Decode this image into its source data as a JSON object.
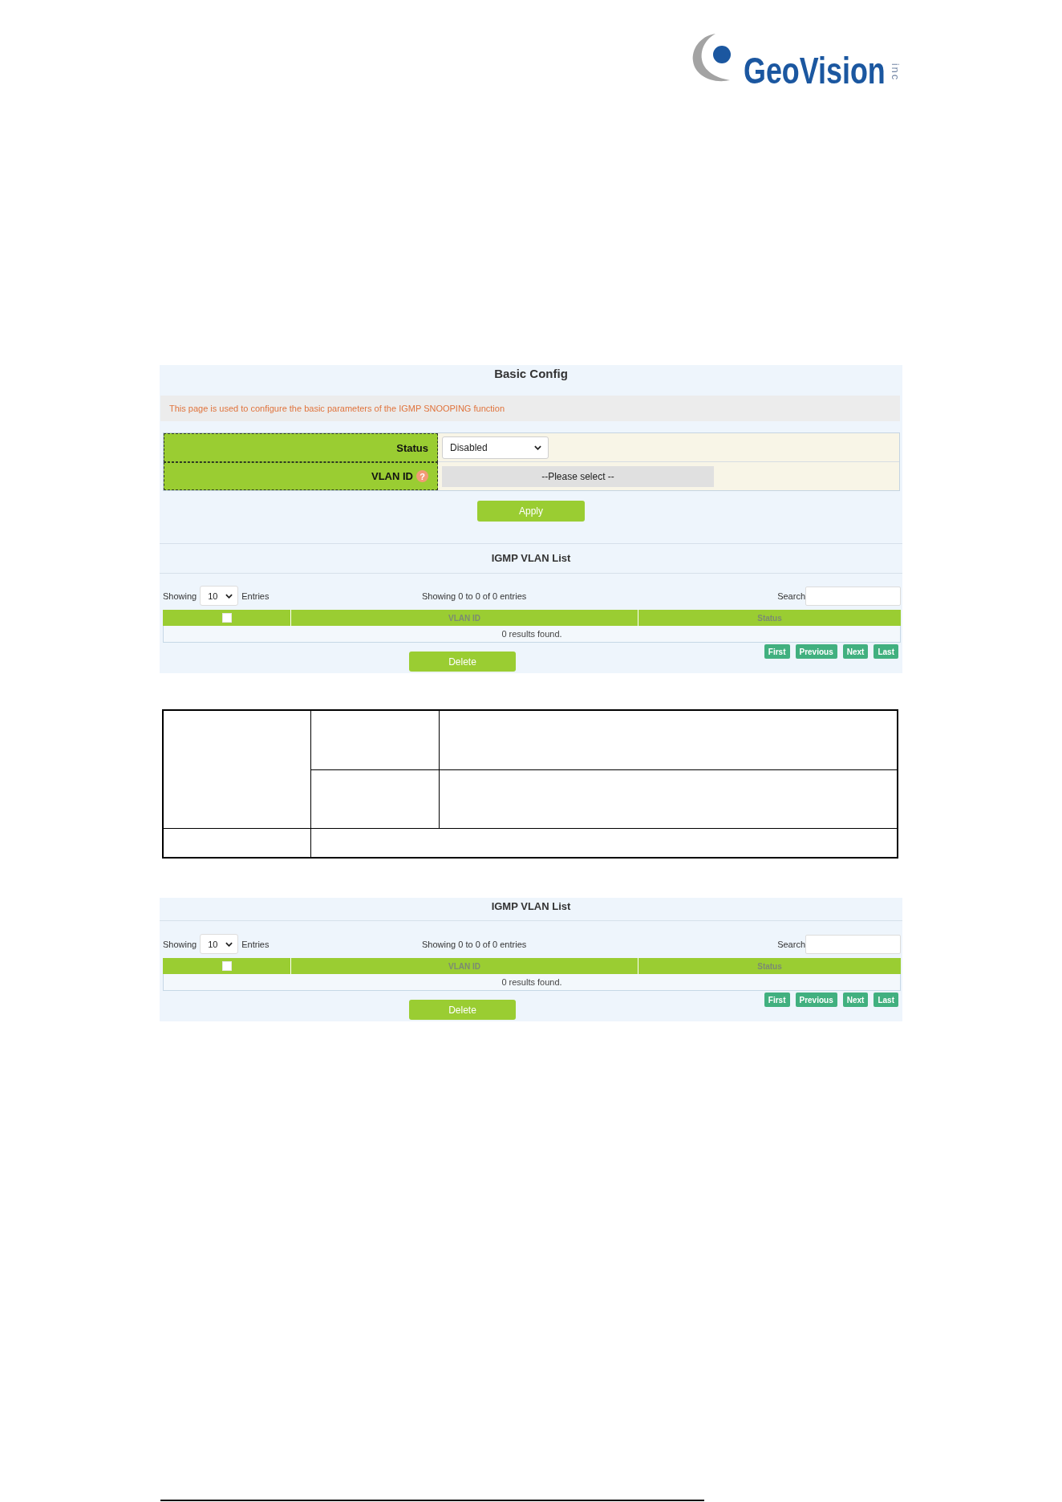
{
  "header": {
    "logo": {
      "wordmark": "GeoVision",
      "suffix": "inc"
    }
  },
  "top_panel": {
    "basic_config": {
      "title": "Basic Config",
      "description": "This page is used to configure the basic parameters of the IGMP SNOOPING function",
      "fields": [
        {
          "kind": "select",
          "label": "Status",
          "value": "Disabled"
        },
        {
          "kind": "picker",
          "label": "VLAN ID",
          "help": "?",
          "value": "--Please select --"
        }
      ],
      "apply_button": "Apply"
    },
    "vlan_list": {
      "title": "IGMP VLAN List",
      "length_label": "Showing",
      "length_value": "10",
      "length_suffix": "Entries",
      "summary": "Showing 0 to 0 of 0 entries",
      "search_label": "Search",
      "select_all": {
        "checked": false
      },
      "columns": [
        "VLAN ID",
        "Status"
      ],
      "empty_message": "0 results found.",
      "delete_button": "Delete",
      "pagination": [
        "First",
        "Previous",
        "Next",
        "Last"
      ]
    }
  },
  "bottom_panel": {
    "vlan_list": {
      "title": "IGMP VLAN List",
      "length_label": "Showing",
      "length_value": "10",
      "length_suffix": "Entries",
      "summary": "Showing 0 to 0 of 0 entries",
      "search_label": "Search",
      "select_all": {
        "checked": false
      },
      "columns": [
        "VLAN ID",
        "Status"
      ],
      "empty_message": "0 results found.",
      "delete_button": "Delete",
      "pagination": [
        "First",
        "Previous",
        "Next",
        "Last"
      ]
    }
  }
}
